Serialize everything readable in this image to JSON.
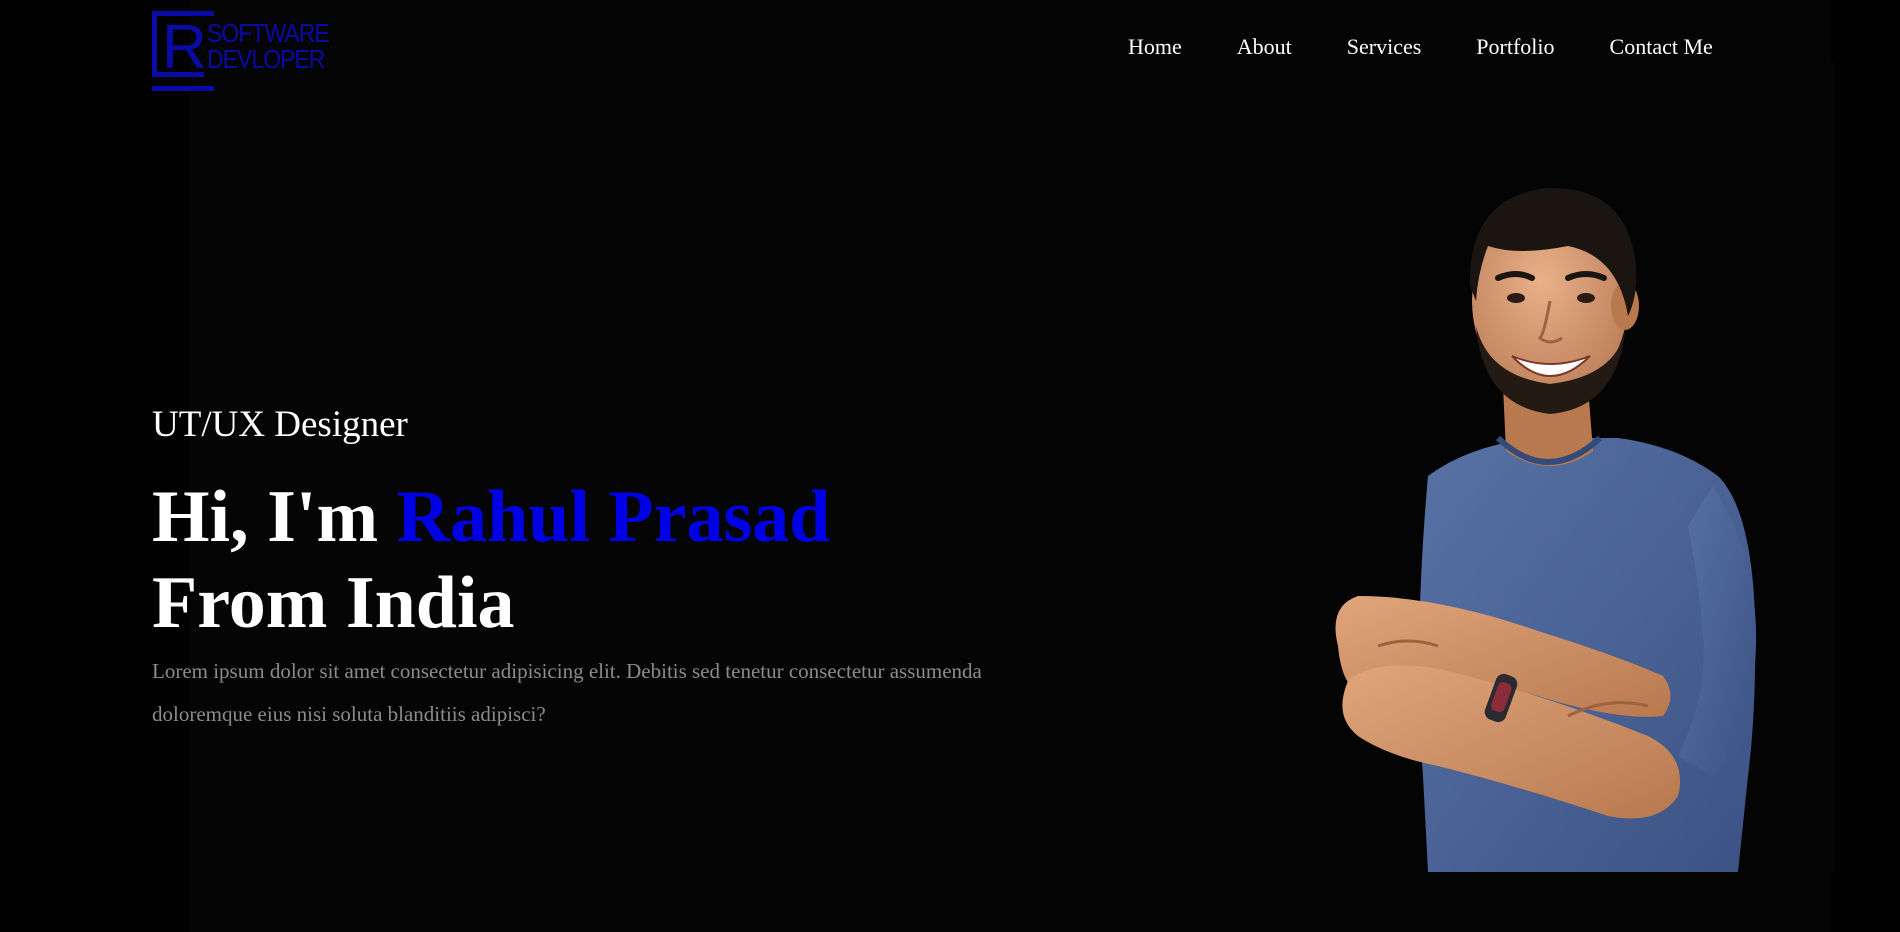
{
  "logo": {
    "letter": "R",
    "line1": "SOFTWARE",
    "line2": "DEVLOPER",
    "color": "#0a0aa8"
  },
  "nav": {
    "items": [
      "Home",
      "About",
      "Services",
      "Portfolio",
      "Contact Me"
    ]
  },
  "hero": {
    "subtitle": "UT/UX Designer",
    "greeting": "Hi, I'm ",
    "name": "Rahul Prasad",
    "origin": "From India",
    "description": "Lorem ipsum dolor sit amet consectetur adipisicing elit. Debitis sed tenetur consectetur assumenda doloremque eius nisi soluta blanditiis adipisci?",
    "name_color": "#0000e6"
  },
  "portrait": {
    "alt": "portrait-photo"
  }
}
